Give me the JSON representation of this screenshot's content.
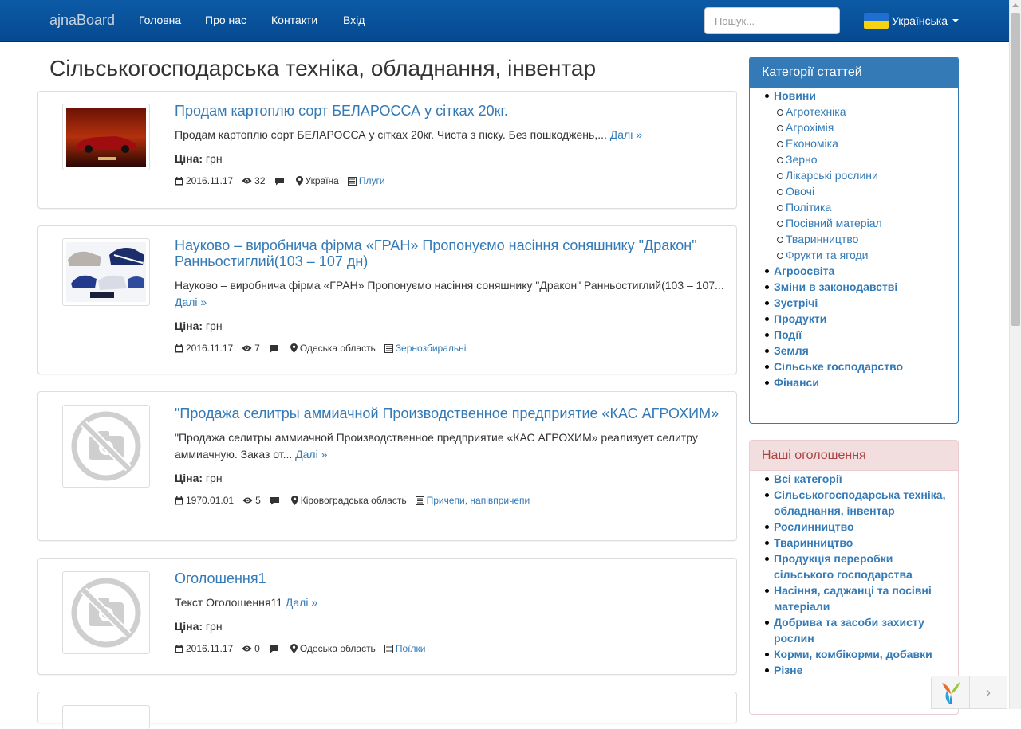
{
  "navbar": {
    "brand": "ajnaBoard",
    "links": [
      "Головна",
      "Про нас",
      "Контакти",
      "Вхід"
    ],
    "search_placeholder": "Пошук...",
    "language": "Українська",
    "flag_colors": [
      "#1f6fd0",
      "#f7d210"
    ]
  },
  "page": {
    "title": "Сільськогосподарська техніка, обладнання, інвентар"
  },
  "listings": [
    {
      "title": "Продам картоплю сорт БЕЛАРОССА у сітках 20кг.",
      "text": "Продам картоплю сорт БЕЛАРОССА у сітках 20кг. Чиста з піску. Без пошкоджень,...",
      "more": "Далі »",
      "price_label": "Ціна:",
      "price_value": "грн",
      "date": "2016.11.17",
      "views": "32",
      "location": "Україна",
      "category": "Плуги",
      "image": "red-sports-car-photo"
    },
    {
      "title": "Науково – виробнича фірма «ГРАН» Пропонуємо насіння соняшнику \"Дракон\" Ранньостиглий(103 – 107 дн)",
      "text": "Науково – виробнича фірма «ГРАН» Пропонуємо насіння соняшнику \"Дракон\" Ранньостиглий(103 – 107...",
      "more": "Далі »",
      "price_label": "Ціна:",
      "price_value": "грн",
      "date": "2016.11.17",
      "views": "7",
      "location": "Одеська область",
      "category": "Зернозбиральні",
      "image": "sports-cars-collage-photo"
    },
    {
      "title": "\"Продажа селитры аммиачной Производственное предприятие «КАС АГРОХИМ»",
      "text": "\"Продажа селитры аммиачной Производственное предприятие «КАС АГРОХИМ» реализует селитру аммиачную. Заказ от...",
      "more": "Далі »",
      "price_label": "Ціна:",
      "price_value": "грн",
      "date": "1970.01.01",
      "views": "5",
      "location": "Кіровоградська область",
      "category": "Причепи, напівпричепи",
      "image": "no-photo-icon"
    },
    {
      "title": "Оголошення1",
      "text": "Текст Оголошення11",
      "more": "Далі »",
      "price_label": "Ціна:",
      "price_value": "грн",
      "date": "2016.11.17",
      "views": "0",
      "location": "Одеська область",
      "category": "Поїлки",
      "image": "no-photo-icon"
    }
  ],
  "sidebar": {
    "categories_heading": "Категорії статтей",
    "categories": [
      {
        "label": "Новини",
        "sub": false
      },
      {
        "label": "Агротехніка",
        "sub": true
      },
      {
        "label": "Агрохімія",
        "sub": true
      },
      {
        "label": "Економіка",
        "sub": true
      },
      {
        "label": "Зерно",
        "sub": true
      },
      {
        "label": "Лікарські рослини",
        "sub": true
      },
      {
        "label": "Овочі",
        "sub": true
      },
      {
        "label": "Політика",
        "sub": true
      },
      {
        "label": "Посівний матеріал",
        "sub": true
      },
      {
        "label": "Тваринництво",
        "sub": true
      },
      {
        "label": "Фрукти та ягоди",
        "sub": true
      },
      {
        "label": "Агроосвіта",
        "sub": false
      },
      {
        "label": "Зміни в законодавстві",
        "sub": false
      },
      {
        "label": "Зустрічі",
        "sub": false
      },
      {
        "label": "Продукти",
        "sub": false
      },
      {
        "label": "Події",
        "sub": false
      },
      {
        "label": "Земля",
        "sub": false
      },
      {
        "label": "Сільське господарство",
        "sub": false
      },
      {
        "label": "Фінанси",
        "sub": false
      }
    ],
    "ads_heading": "Наші оголошення",
    "ads_categories": [
      "Всі категорії",
      "Сільськогосподарська техніка, обладнання, інвентар",
      "Рослинництво",
      "Тваринництво",
      "Продукція переробки сільського господарства",
      "Насіння, саджанці та посівні матеріали",
      "Добрива та засоби захисту рослин",
      "Корми, комбікорми, добавки",
      "Різне"
    ]
  },
  "debug_toolbar": {
    "logo": "yii-logo-icon",
    "toggle": "›"
  }
}
